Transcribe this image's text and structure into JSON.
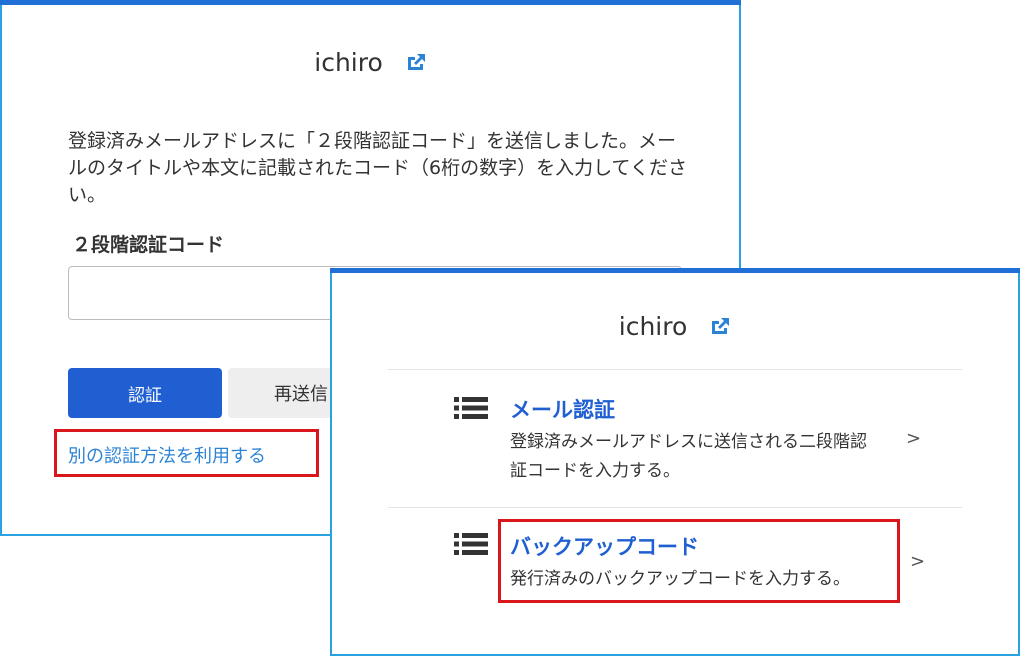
{
  "panel1": {
    "username": "ichiro",
    "message": "登録済みメールアドレスに「２段階認証コード」を送信しました。メールのタイトルや本文に記載されたコード（6桁の数字）を入力してください。",
    "field_label": "２段階認証コード",
    "code_value": "",
    "verify_button": "認証",
    "resend_button": "再送信",
    "alt_method_link": "別の認証方法を利用する"
  },
  "panel2": {
    "username": "ichiro",
    "options": [
      {
        "icon": "list-icon",
        "title": "メール認証",
        "desc_line1": "登録済みメールアドレスに送信される二段階認",
        "desc_line2": "証コードを入力する。",
        "chevron": ">"
      },
      {
        "icon": "list-icon",
        "title": "バックアップコード",
        "desc_line1": "発行済みのバックアップコードを入力する。",
        "chevron": ">"
      }
    ]
  },
  "colors": {
    "accent": "#1f5fd1",
    "link": "#2b83d6",
    "panel_border": "#29a3e0",
    "highlight": "#d9161c"
  }
}
